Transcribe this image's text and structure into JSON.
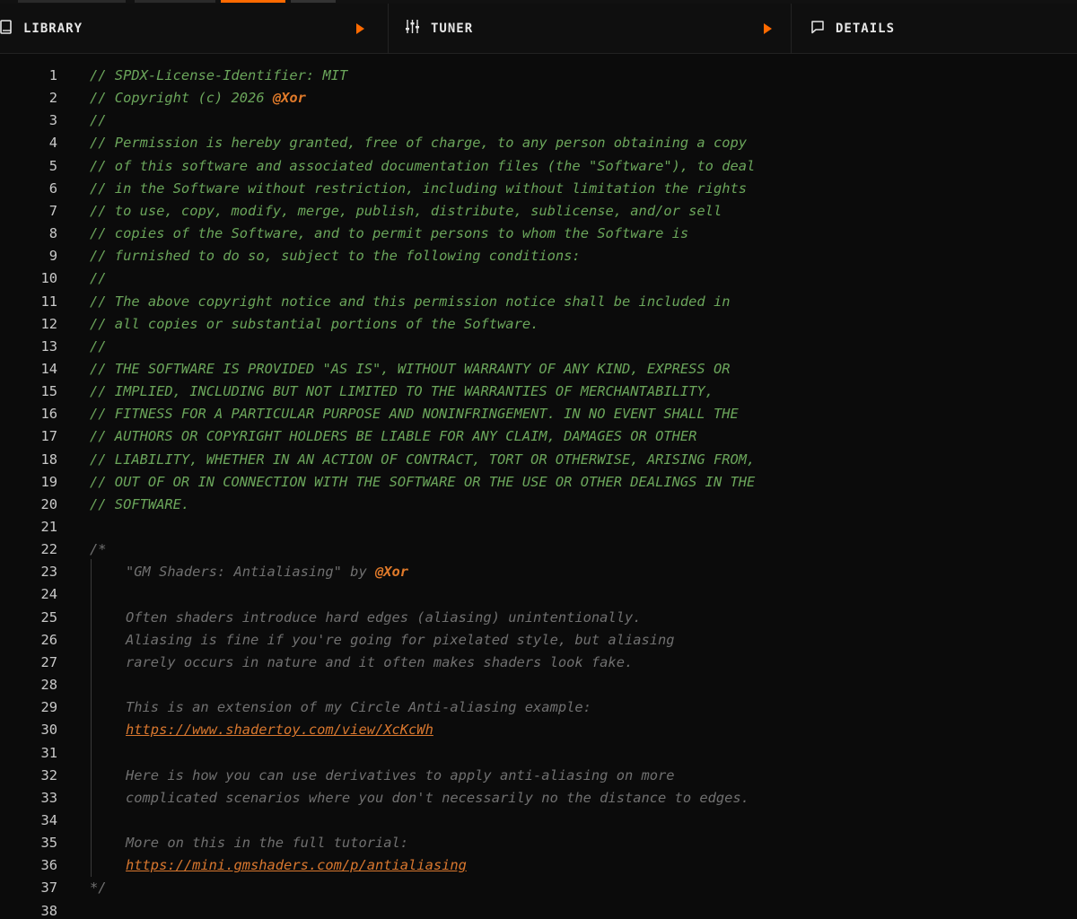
{
  "panels": {
    "library": {
      "label": "LIBRARY",
      "icon": "book-icon"
    },
    "tuner": {
      "label": "TUNER",
      "icon": "sliders-icon"
    },
    "details": {
      "label": "DETAILS",
      "icon": "comment-icon"
    }
  },
  "colors": {
    "accent": "#ff6a00",
    "comment": "#6ba65b",
    "block_comment": "#707070",
    "handle": "#e07a2a",
    "line_number": "#c9c9c9",
    "background": "#0b0b0b"
  },
  "editor": {
    "lines": [
      {
        "n": "1",
        "style": "green",
        "parts": [
          {
            "t": "// SPDX-License-Identifier: MIT"
          }
        ]
      },
      {
        "n": "2",
        "style": "green",
        "parts": [
          {
            "t": "// Copyright (c) 2026 "
          },
          {
            "t": "@Xor",
            "k": "handle"
          }
        ]
      },
      {
        "n": "3",
        "style": "green",
        "parts": [
          {
            "t": "//"
          }
        ]
      },
      {
        "n": "4",
        "style": "green",
        "parts": [
          {
            "t": "// Permission is hereby granted, free of charge, to any person obtaining a copy"
          }
        ]
      },
      {
        "n": "5",
        "style": "green",
        "parts": [
          {
            "t": "// of this software and associated documentation files (the \"Software\"), to deal"
          }
        ]
      },
      {
        "n": "6",
        "style": "green",
        "parts": [
          {
            "t": "// in the Software without restriction, including without limitation the rights"
          }
        ]
      },
      {
        "n": "7",
        "style": "green",
        "parts": [
          {
            "t": "// to use, copy, modify, merge, publish, distribute, sublicense, and/or sell"
          }
        ]
      },
      {
        "n": "8",
        "style": "green",
        "parts": [
          {
            "t": "// copies of the Software, and to permit persons to whom the Software is"
          }
        ]
      },
      {
        "n": "9",
        "style": "green",
        "parts": [
          {
            "t": "// furnished to do so, subject to the following conditions:"
          }
        ]
      },
      {
        "n": "10",
        "style": "green",
        "parts": [
          {
            "t": "//"
          }
        ]
      },
      {
        "n": "11",
        "style": "green",
        "parts": [
          {
            "t": "// The above copyright notice and this permission notice shall be included in"
          }
        ]
      },
      {
        "n": "12",
        "style": "green",
        "parts": [
          {
            "t": "// all copies or substantial portions of the Software."
          }
        ]
      },
      {
        "n": "13",
        "style": "green",
        "parts": [
          {
            "t": "//"
          }
        ]
      },
      {
        "n": "14",
        "style": "green",
        "parts": [
          {
            "t": "// THE SOFTWARE IS PROVIDED \"AS IS\", WITHOUT WARRANTY OF ANY KIND, EXPRESS OR"
          }
        ]
      },
      {
        "n": "15",
        "style": "green",
        "parts": [
          {
            "t": "// IMPLIED, INCLUDING BUT NOT LIMITED TO THE WARRANTIES OF MERCHANTABILITY,"
          }
        ]
      },
      {
        "n": "16",
        "style": "green",
        "parts": [
          {
            "t": "// FITNESS FOR A PARTICULAR PURPOSE AND NONINFRINGEMENT. IN NO EVENT SHALL THE"
          }
        ]
      },
      {
        "n": "17",
        "style": "green",
        "parts": [
          {
            "t": "// AUTHORS OR COPYRIGHT HOLDERS BE LIABLE FOR ANY CLAIM, DAMAGES OR OTHER"
          }
        ]
      },
      {
        "n": "18",
        "style": "green",
        "parts": [
          {
            "t": "// LIABILITY, WHETHER IN AN ACTION OF CONTRACT, TORT OR OTHERWISE, ARISING FROM,"
          }
        ]
      },
      {
        "n": "19",
        "style": "green",
        "parts": [
          {
            "t": "// OUT OF OR IN CONNECTION WITH THE SOFTWARE OR THE USE OR OTHER DEALINGS IN THE"
          }
        ]
      },
      {
        "n": "20",
        "style": "green",
        "parts": [
          {
            "t": "// SOFTWARE."
          }
        ]
      },
      {
        "n": "21",
        "style": "green",
        "parts": []
      },
      {
        "n": "22",
        "style": "gray",
        "parts": [
          {
            "t": "/*"
          }
        ]
      },
      {
        "n": "23",
        "style": "gray",
        "indent": true,
        "parts": [
          {
            "t": "\"GM Shaders: Antialiasing\" by "
          },
          {
            "t": "@Xor",
            "k": "handle"
          }
        ]
      },
      {
        "n": "24",
        "style": "gray",
        "parts": []
      },
      {
        "n": "25",
        "style": "gray",
        "indent": true,
        "parts": [
          {
            "t": "Often shaders introduce hard edges (aliasing) unintentionally."
          }
        ]
      },
      {
        "n": "26",
        "style": "gray",
        "indent": true,
        "parts": [
          {
            "t": "Aliasing is fine if you're going for pixelated style, but aliasing"
          }
        ]
      },
      {
        "n": "27",
        "style": "gray",
        "indent": true,
        "parts": [
          {
            "t": "rarely occurs in nature and it often makes shaders look fake."
          }
        ]
      },
      {
        "n": "28",
        "style": "gray",
        "parts": []
      },
      {
        "n": "29",
        "style": "gray",
        "indent": true,
        "parts": [
          {
            "t": "This is an extension of my Circle Anti-aliasing example:"
          }
        ]
      },
      {
        "n": "30",
        "style": "gray",
        "indent": true,
        "parts": [
          {
            "t": "https://www.shadertoy.com/view/XcKcWh",
            "k": "link"
          }
        ]
      },
      {
        "n": "31",
        "style": "gray",
        "parts": []
      },
      {
        "n": "32",
        "style": "gray",
        "indent": true,
        "parts": [
          {
            "t": "Here is how you can use derivatives to apply anti-aliasing on more"
          }
        ]
      },
      {
        "n": "33",
        "style": "gray",
        "indent": true,
        "parts": [
          {
            "t": "complicated scenarios where you don't necessarily no the distance to edges."
          }
        ]
      },
      {
        "n": "34",
        "style": "gray",
        "parts": []
      },
      {
        "n": "35",
        "style": "gray",
        "indent": true,
        "parts": [
          {
            "t": "More on this in the full tutorial:"
          }
        ]
      },
      {
        "n": "36",
        "style": "gray",
        "indent": true,
        "parts": [
          {
            "t": "https://mini.gmshaders.com/p/antialiasing",
            "k": "link"
          }
        ]
      },
      {
        "n": "37",
        "style": "gray",
        "parts": [
          {
            "t": "*/"
          }
        ]
      },
      {
        "n": "38",
        "style": "gray",
        "parts": []
      }
    ]
  }
}
